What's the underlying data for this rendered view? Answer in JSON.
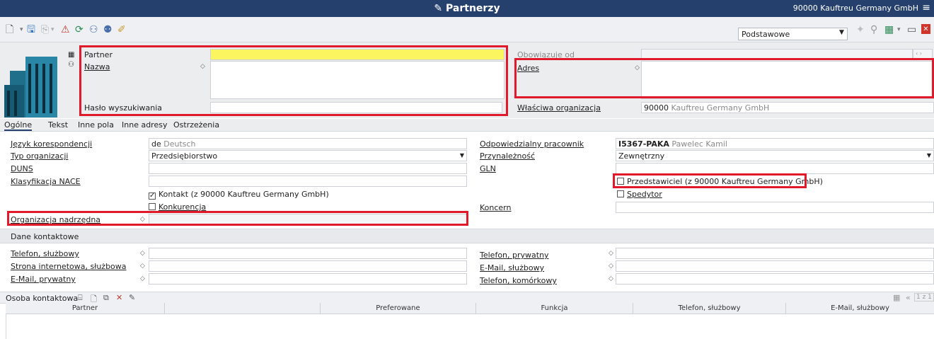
{
  "title": "Partnerzy",
  "title_icon": "pen-icon",
  "org_info": "90000  Kauftreu Germany GmbH",
  "view_select": "Podstawowe",
  "header": {
    "partner_label": "Partner",
    "partner_value": "",
    "nazwa_label": "Nazwa",
    "haslo_label": "Hasło wyszukiwania",
    "obowiazuje_label": "Obowiązuje od",
    "adres_label": "Adres",
    "wlasciwa_label": "Właściwa organizacja",
    "wlasciwa_code": "90000",
    "wlasciwa_name": "Kauftreu Germany GmbH"
  },
  "tabs": [
    "Ogólne",
    "Tekst",
    "Inne pola",
    "Inne adresy",
    "Ostrzeżenia"
  ],
  "general": {
    "jezyk_label": "Język korespondencji",
    "jezyk_code": "de",
    "jezyk_name": "Deutsch",
    "typ_label": "Typ organizacji",
    "typ_value": "Przedsiębiorstwo",
    "duns_label": "DUNS",
    "nace_label": "Klasyfikacja NACE",
    "kontakt_label": "Kontakt (z 90000 Kauftreu Germany GmbH)",
    "kontakt_checked": true,
    "konkurencja_label": "Konkurencja",
    "nadrzedna_label": "Organizacja nadrzędna",
    "odp_label": "Odpowiedzialny pracownik",
    "odp_code": "I5367-PAKA",
    "odp_name": "Pawelec Kamil",
    "przyn_label": "Przynależność",
    "przyn_value": "Zewnętrzny",
    "gln_label": "GLN",
    "przedst_label": "Przedstawiciel (z 90000 Kauftreu Germany GmbH)",
    "spedytor_label": "Spedytor",
    "koncern_label": "Koncern"
  },
  "contact_section": "Dane kontaktowe",
  "contact": {
    "tel_sl": "Telefon, służbowy",
    "www_sl": "Strona internetowa, służbowa",
    "email_pr": "E-Mail, prywatny",
    "tel_pr": "Telefon, prywatny",
    "email_sl": "E-Mail, służbowy",
    "tel_kom": "Telefon, komórkowy"
  },
  "grid": {
    "title": "Osoba kontaktowa",
    "pager": "1 z 1",
    "columns": [
      "Partner",
      "",
      "Preferowane",
      "Funkcja",
      "Telefon, służbowy",
      "E-Mail, służbowy"
    ]
  }
}
